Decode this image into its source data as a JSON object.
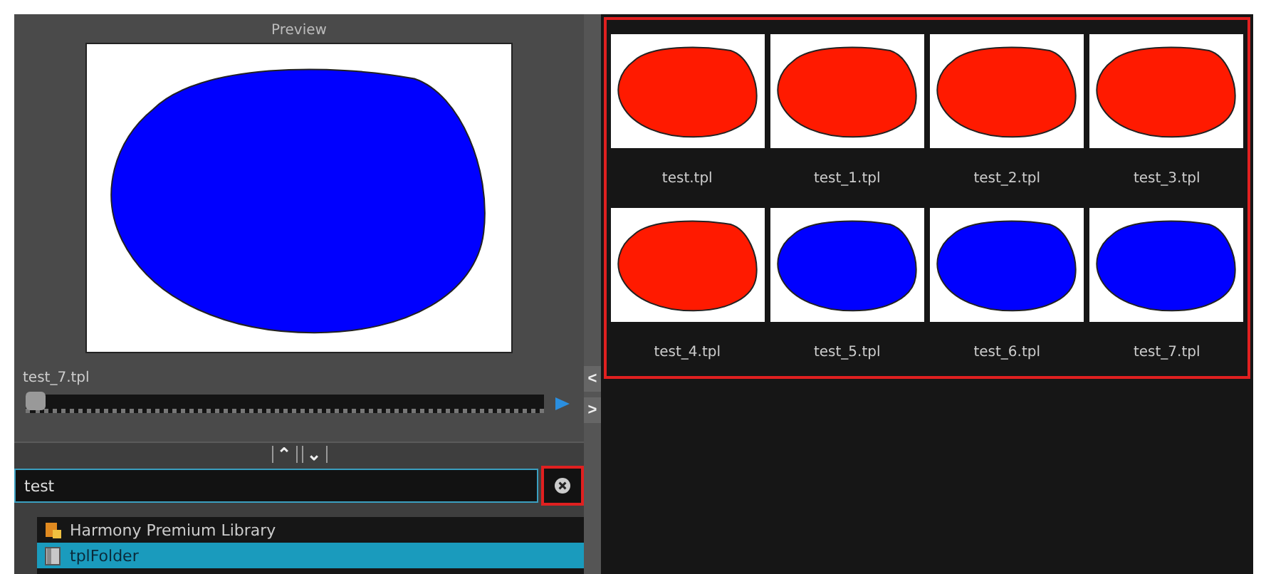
{
  "preview": {
    "title": "Preview",
    "color": "#0000ff",
    "name": "test_7.tpl",
    "slider": {
      "level": 0
    }
  },
  "splitter": {
    "up": "⌃",
    "down": "⌄"
  },
  "search": {
    "value": "test",
    "highlighted": true
  },
  "tree": [
    {
      "label": "Harmony Premium Library",
      "selected": false,
      "kind": "library"
    },
    {
      "label": "tplFolder",
      "selected": true,
      "kind": "folder"
    }
  ],
  "side_arrows": [
    "<",
    ">"
  ],
  "templates": {
    "highlighted": true,
    "items": [
      {
        "name": "test.tpl",
        "color": "#ff1a00"
      },
      {
        "name": "test_1.tpl",
        "color": "#ff1a00"
      },
      {
        "name": "test_2.tpl",
        "color": "#ff1a00"
      },
      {
        "name": "test_3.tpl",
        "color": "#ff1a00"
      },
      {
        "name": "test_4.tpl",
        "color": "#ff1a00"
      },
      {
        "name": "test_5.tpl",
        "color": "#0000ff"
      },
      {
        "name": "test_6.tpl",
        "color": "#0000ff"
      },
      {
        "name": "test_7.tpl",
        "color": "#0000ff"
      }
    ]
  }
}
